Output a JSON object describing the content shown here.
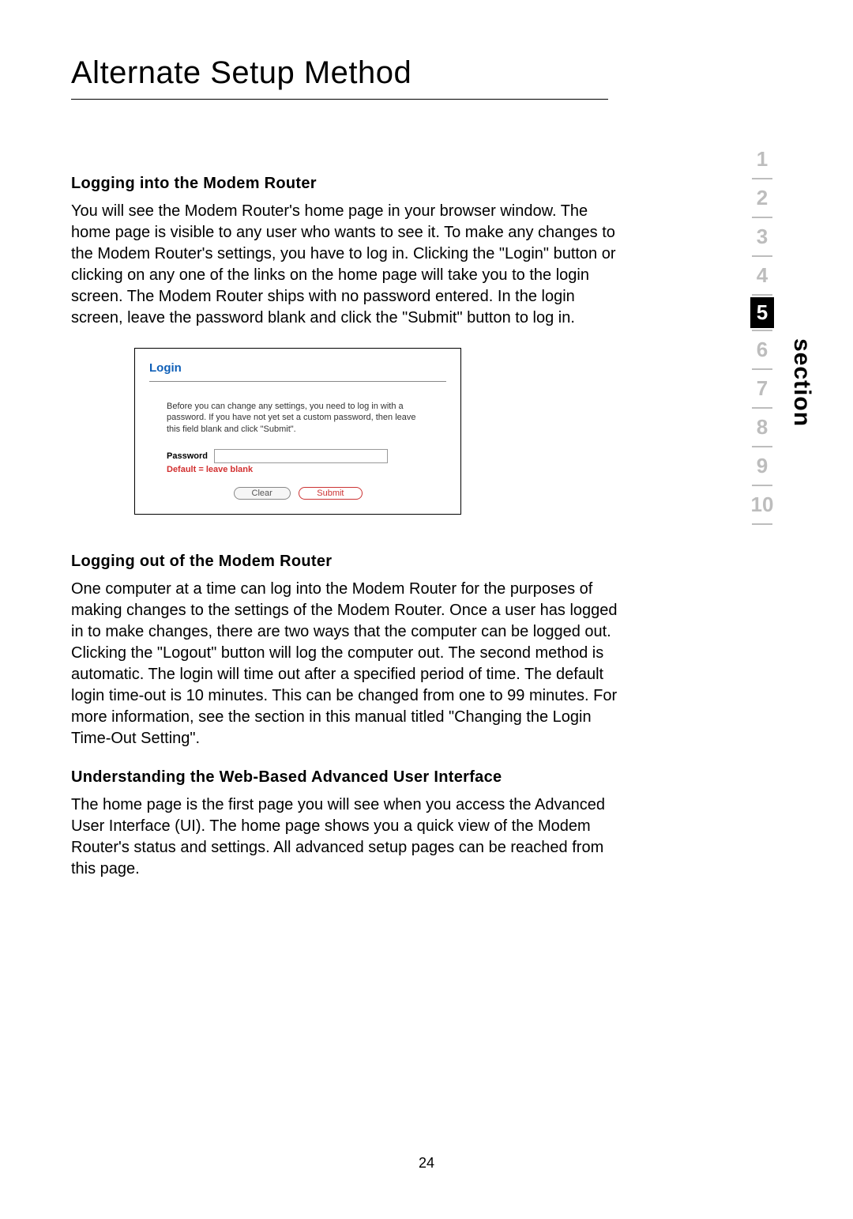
{
  "title": "Alternate Setup Method",
  "sections": {
    "s1": {
      "heading": "Logging into the Modem Router",
      "body": "You will see the Modem Router's home page in your browser window. The home page is visible to any user who wants to see it. To make any changes to the Modem Router's settings, you have to log in. Clicking the \"Login\" button or clicking on any one of the links on the home page will take you to the login screen. The Modem Router ships with no password entered. In the login screen, leave the password blank and click the \"Submit\" button to log in."
    },
    "s2": {
      "heading": "Logging out of the Modem Router",
      "body": "One computer at a time can log into the Modem Router for the purposes of making changes to the settings of the Modem Router. Once a user has logged in to make changes, there are two ways that the computer can be logged out. Clicking the \"Logout\" button will log the computer out. The second method is automatic. The login will time out after a specified period of time. The default login time-out is 10 minutes. This can be changed from one to 99 minutes. For more information, see the section in this manual titled \"Changing the Login Time-Out Setting\"."
    },
    "s3": {
      "heading": "Understanding the Web-Based Advanced User Interface",
      "body": "The home page is the first page you will see when you access the Advanced User Interface (UI). The home page shows you a quick view of the Modem Router's status and settings. All advanced setup pages can be reached from this page."
    }
  },
  "login_shot": {
    "title": "Login",
    "instructions": "Before you can change any settings, you need to log in with a password. If you have not yet set a custom password, then leave this field blank and click \"Submit\".",
    "password_label": "Password",
    "password_hint": "Default = leave blank",
    "clear_label": "Clear",
    "submit_label": "Submit"
  },
  "nav": {
    "label": "section",
    "items": [
      "1",
      "2",
      "3",
      "4",
      "5",
      "6",
      "7",
      "8",
      "9",
      "10"
    ],
    "active": "5"
  },
  "page_number": "24"
}
